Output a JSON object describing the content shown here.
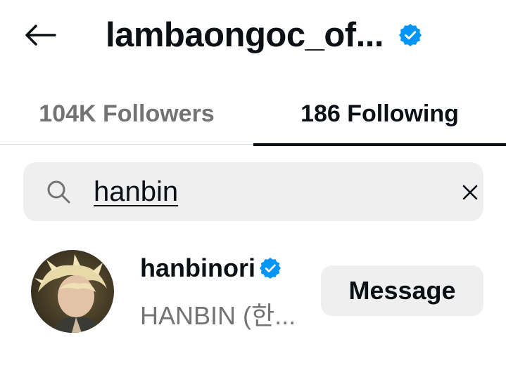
{
  "header": {
    "title": "lambaongoc_of...",
    "back_icon": "arrow-left-icon",
    "verified_icon": "verified-badge-icon"
  },
  "tabs": [
    {
      "label": "104K Followers",
      "active": false
    },
    {
      "label": "186 Following",
      "active": true
    }
  ],
  "search": {
    "value": "hanbin",
    "icon": "search-icon",
    "clear_icon": "close-icon"
  },
  "results": [
    {
      "username": "hanbinori",
      "full_name": "HANBIN (한...",
      "verified": true,
      "button_label": "Message"
    }
  ],
  "colors": {
    "verified": "#0095f6",
    "primary_text": "#0c1014",
    "secondary_text": "#737373",
    "surface": "#efefef",
    "divider": "#dbdbdb"
  }
}
